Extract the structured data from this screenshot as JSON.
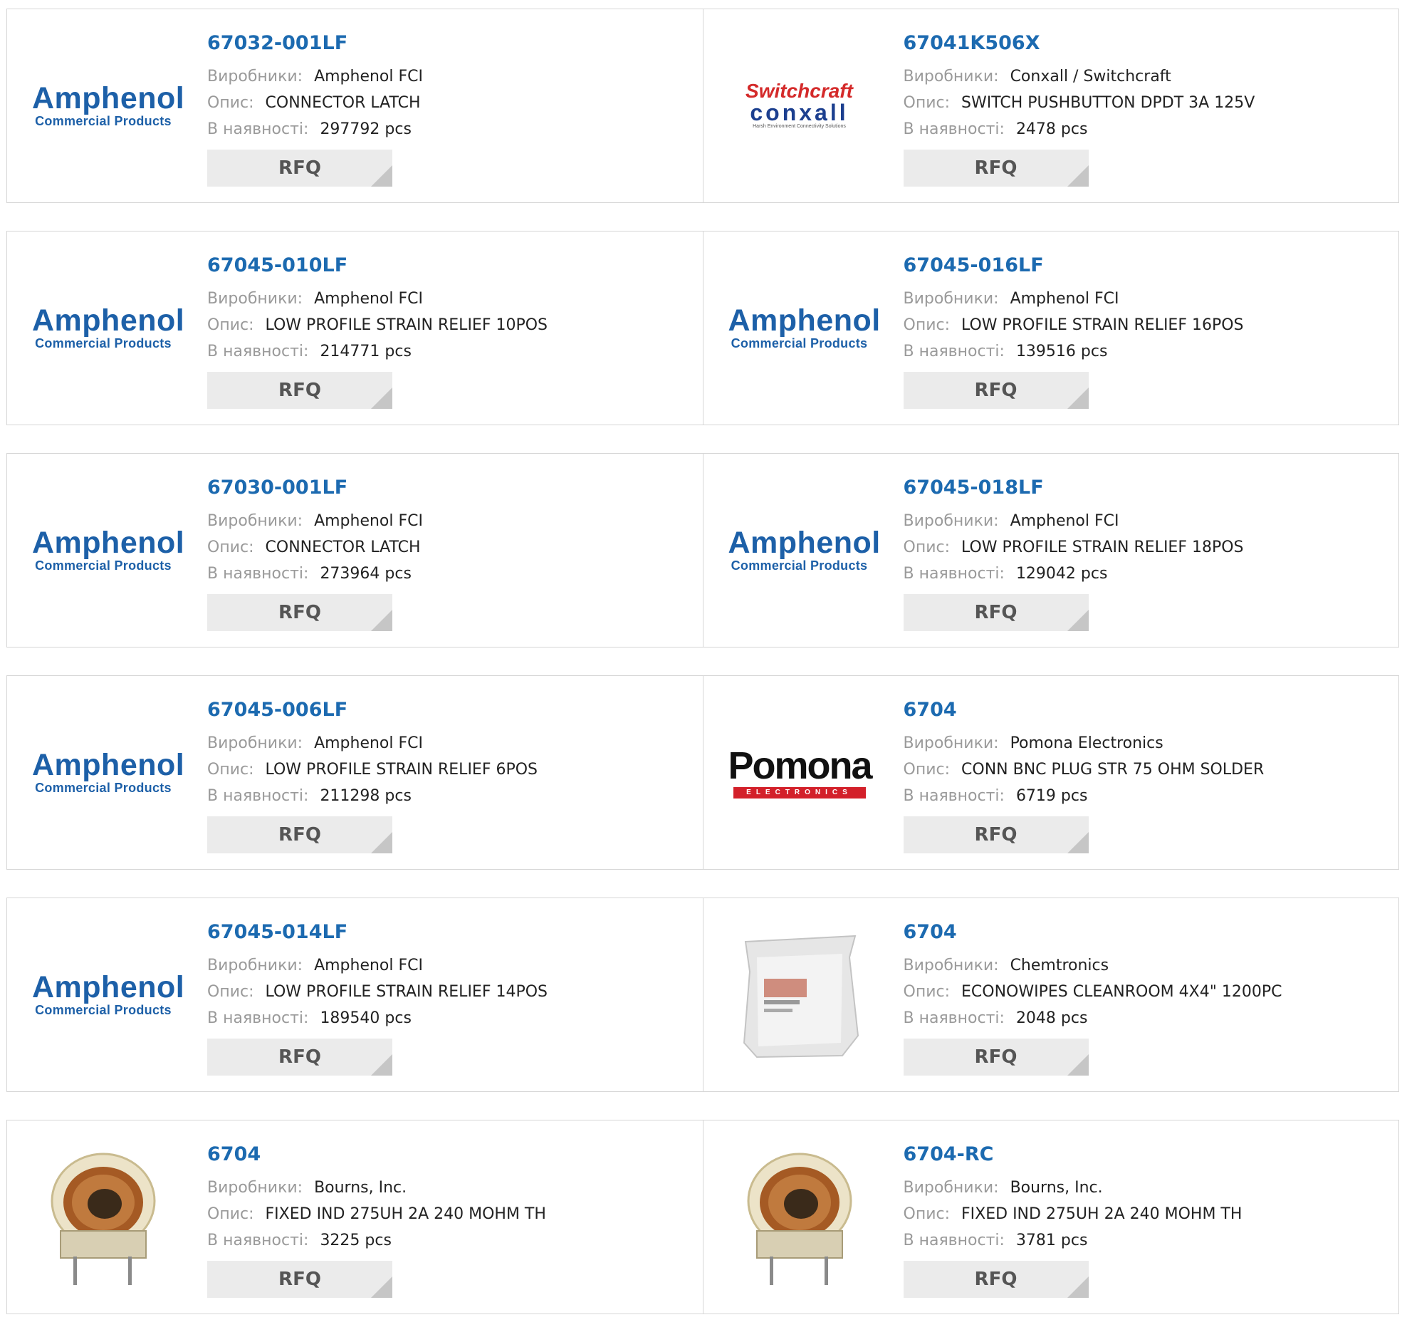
{
  "labels": {
    "manufacturer": "Виробники:",
    "description": "Опис:",
    "stock": "В наявності:",
    "rfq": "RFQ"
  },
  "products": [
    {
      "part": "67032-001LF",
      "manufacturer": "Amphenol FCI",
      "description": "CONNECTOR LATCH",
      "stock": "297792 pcs",
      "logo": "amphenol-logo"
    },
    {
      "part": "67041K506X",
      "manufacturer": "Conxall / Switchcraft",
      "description": "SWITCH PUSHBUTTON DPDT 3A 125V",
      "stock": "2478 pcs",
      "logo": "switchcraft-conxall-logo"
    },
    {
      "part": "67045-010LF",
      "manufacturer": "Amphenol FCI",
      "description": "LOW PROFILE STRAIN RELIEF 10POS",
      "stock": "214771 pcs",
      "logo": "amphenol-logo"
    },
    {
      "part": "67045-016LF",
      "manufacturer": "Amphenol FCI",
      "description": "LOW PROFILE STRAIN RELIEF 16POS",
      "stock": "139516 pcs",
      "logo": "amphenol-logo"
    },
    {
      "part": "67030-001LF",
      "manufacturer": "Amphenol FCI",
      "description": "CONNECTOR LATCH",
      "stock": "273964 pcs",
      "logo": "amphenol-logo"
    },
    {
      "part": "67045-018LF",
      "manufacturer": "Amphenol FCI",
      "description": "LOW PROFILE STRAIN RELIEF 18POS",
      "stock": "129042 pcs",
      "logo": "amphenol-logo"
    },
    {
      "part": "67045-006LF",
      "manufacturer": "Amphenol FCI",
      "description": "LOW PROFILE STRAIN RELIEF 6POS",
      "stock": "211298 pcs",
      "logo": "amphenol-logo"
    },
    {
      "part": "6704",
      "manufacturer": "Pomona Electronics",
      "description": "CONN BNC PLUG STR 75 OHM SOLDER",
      "stock": "6719 pcs",
      "logo": "pomona-logo"
    },
    {
      "part": "67045-014LF",
      "manufacturer": "Amphenol FCI",
      "description": "LOW PROFILE STRAIN RELIEF 14POS",
      "stock": "189540 pcs",
      "logo": "amphenol-logo"
    },
    {
      "part": "6704",
      "manufacturer": "Chemtronics",
      "description": "ECONOWIPES CLEANROOM 4X4\" 1200PC",
      "stock": "2048 pcs",
      "logo": "wipes-package-image"
    },
    {
      "part": "6704",
      "manufacturer": "Bourns, Inc.",
      "description": "FIXED IND 275UH 2A 240 MOHM TH",
      "stock": "3225 pcs",
      "logo": "toroid-inductor-image"
    },
    {
      "part": "6704-RC",
      "manufacturer": "Bourns, Inc.",
      "description": "FIXED IND 275UH 2A 240 MOHM TH",
      "stock": "3781 pcs",
      "logo": "toroid-inductor-image"
    }
  ],
  "logos": {
    "amphenol": {
      "line1": "Amphenol",
      "line2": "Commercial Products"
    },
    "switchcraft": {
      "line1": "Switchcraft",
      "line2": "conxall",
      "line3": "Harsh Environment Connectivity Solutions"
    },
    "pomona": {
      "line1": "Pomona",
      "line2": "ELECTRONICS"
    }
  },
  "colors": {
    "part_link": "#1c6ab0",
    "label": "#9a9a9a",
    "button_bg": "#ebebeb",
    "border": "#d6d6d6"
  }
}
